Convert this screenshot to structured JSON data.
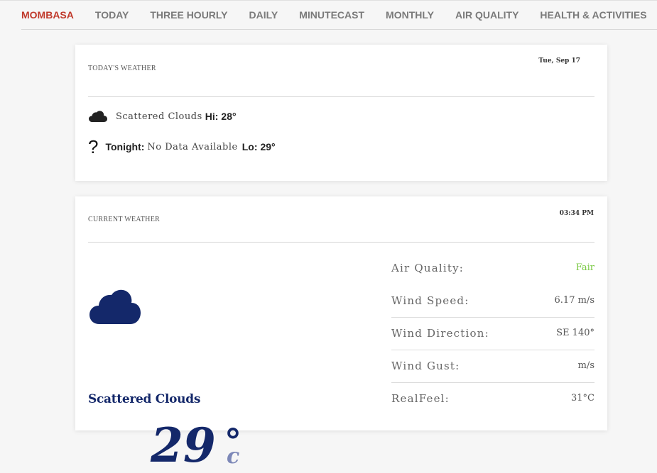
{
  "nav": {
    "items": [
      "MOMBASA",
      "TODAY",
      "THREE HOURLY",
      "DAILY",
      "MINUTECAST",
      "MONTHLY",
      "AIR QUALITY",
      "HEALTH & ACTIVITIES"
    ],
    "active_index": 0
  },
  "today": {
    "title": "TODAY'S WEATHER",
    "date": "Tue, Sep 17",
    "day": {
      "icon": "cloud-icon",
      "condition": "Scattered Clouds",
      "hi_label": "Hi:",
      "hi_value": "28°"
    },
    "night": {
      "icon": "question-mark-icon",
      "icon_glyph": "?",
      "tonight_label": "Tonight:",
      "condition": "No Data Available",
      "lo_label": "Lo:",
      "lo_value": "29°"
    }
  },
  "current": {
    "title": "CURRENT WEATHER",
    "time": "03:34 PM",
    "icon": "cloud-icon",
    "temperature": "29",
    "degree_symbol": "°",
    "unit": "c",
    "condition": "Scattered Clouds",
    "metrics": [
      {
        "label": "Air Quality:",
        "value": "Fair",
        "value_color": "#7ac943"
      },
      {
        "label": "Wind Speed:",
        "value": "6.17 m/s"
      },
      {
        "label": "Wind Direction:",
        "value": "SE 140°"
      },
      {
        "label": "Wind Gust:",
        "value": "m/s"
      },
      {
        "label": "RealFeel:",
        "value": "31°C"
      }
    ]
  },
  "colors": {
    "accent_active": "#c0392b",
    "primary_navy": "#14286a",
    "air_quality_fair": "#7ac943"
  }
}
